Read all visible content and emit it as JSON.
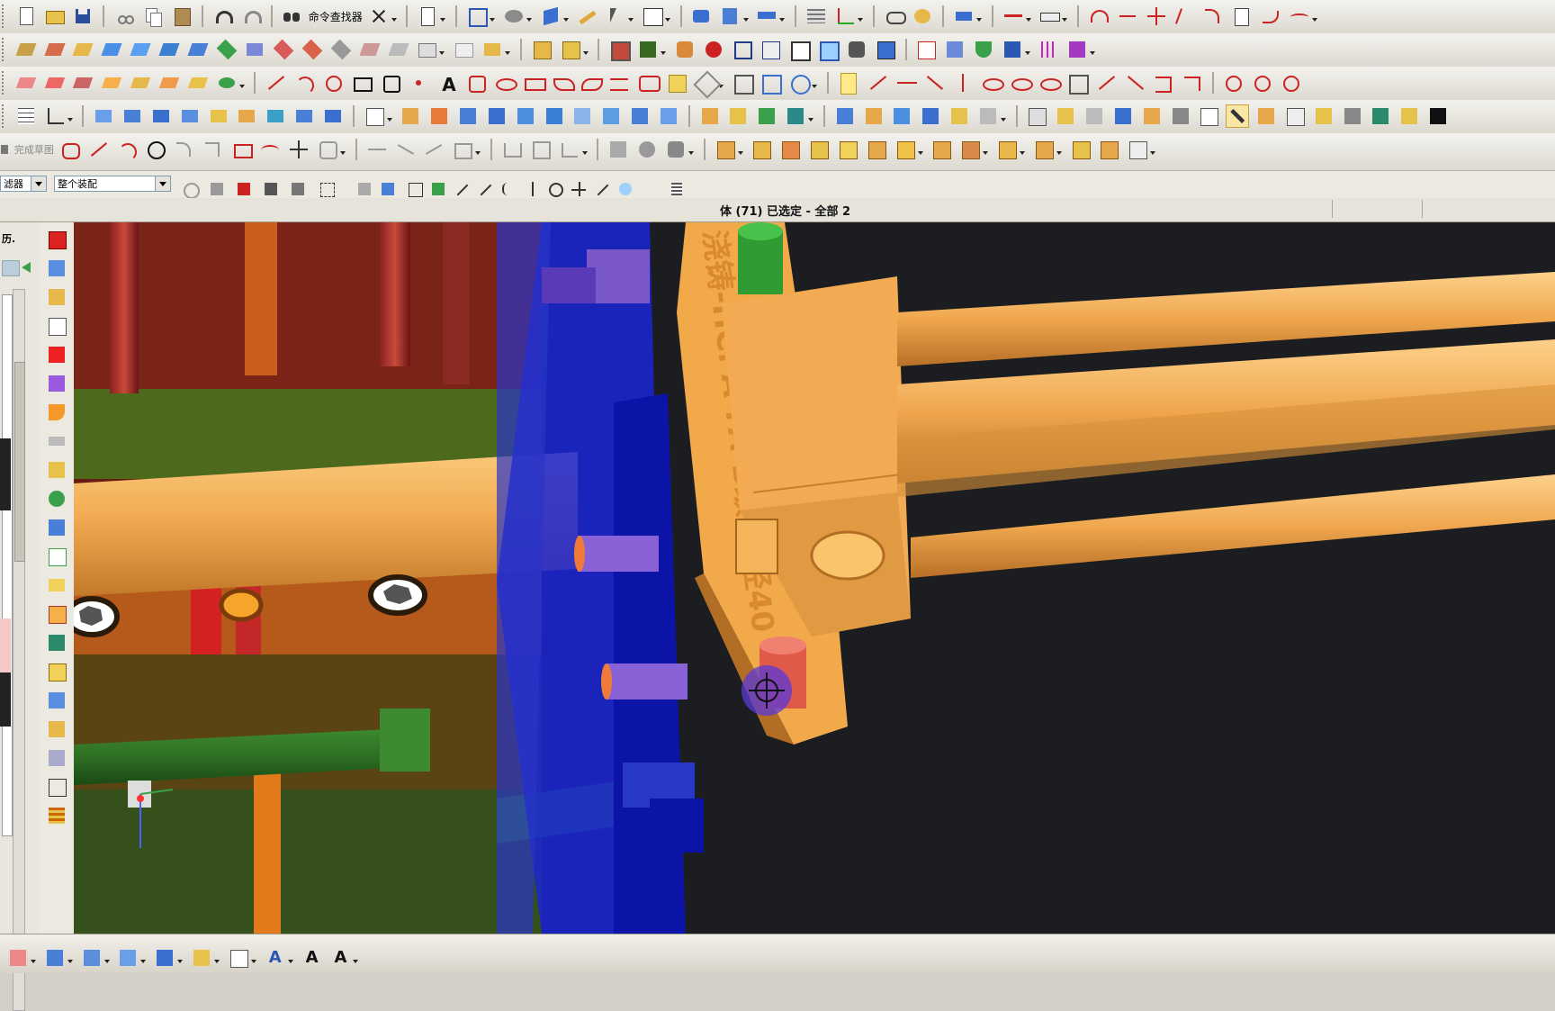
{
  "toolbar": {
    "command_finder_label": "命令查找器"
  },
  "sketch_bar": {
    "finish_sketch_label": "完成草图"
  },
  "filter_bar": {
    "type_filter_value": "滤器",
    "scope_filter_value": "整个装配"
  },
  "status": {
    "selection_text": "体 (71) 已选定 - 全部 2"
  },
  "left_panel": {
    "history_label": "历."
  },
  "viewport": {
    "part_engraving": "浇铸-HC. A-FA-B级-直径40",
    "background_color": "#1c1d20",
    "colors": {
      "orange": "#f2a94a",
      "blue": "#1a24d6",
      "green": "#2f9b32",
      "red": "#d93a2e"
    }
  },
  "icons": [
    "new-icon",
    "open-icon",
    "save-icon",
    "cut-icon",
    "copy-icon",
    "paste-icon",
    "undo-icon",
    "redo-icon",
    "close-icon",
    "cursor-icon",
    "view-icon",
    "cube-icon",
    "line-icon",
    "arc-icon",
    "circle-icon",
    "rectangle-icon",
    "text-icon",
    "crosshair-icon"
  ]
}
